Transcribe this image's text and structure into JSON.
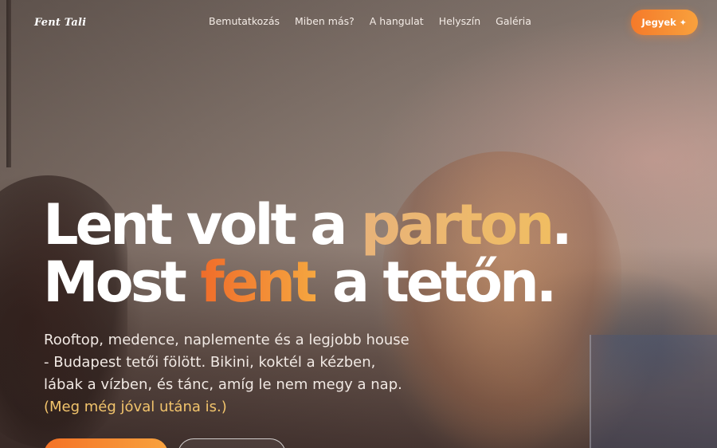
{
  "brand": {
    "name": "Fent Tali"
  },
  "nav": {
    "links": [
      "Bemutatkozás",
      "Miben más?",
      "A hangulat",
      "Helyszín",
      "Galéria"
    ]
  },
  "cta": {
    "label": "Jegyek",
    "icon": "sparkle-icon"
  },
  "hero": {
    "line1": {
      "before": "Lent volt a ",
      "accent": "parton",
      "after": "."
    },
    "line2": {
      "before": "Most ",
      "accent": "fent",
      "after": " a tetőn."
    },
    "subtext": "Rooftop, medence, naplemente és a legjobb house - Budapest tetői fölött. Bikini, koktél a kézben, lábak a vízben, és tánc, amíg le nem megy a nap.",
    "subtext_accent": "(Meg még jóval utána is.)"
  },
  "colors": {
    "accent_orange": "#f57a2a",
    "accent_gold": "#f0bd62"
  }
}
